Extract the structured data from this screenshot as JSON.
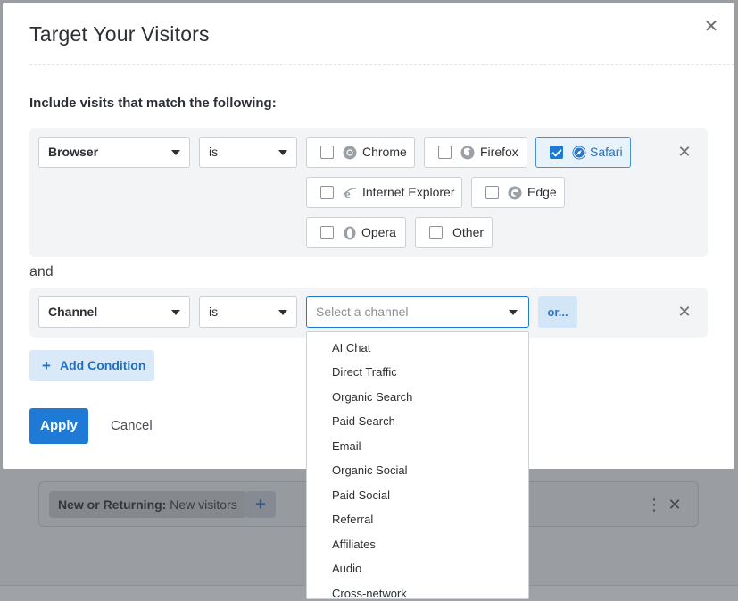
{
  "background": {
    "filter_chip_label": "New or Returning:",
    "filter_chip_value": "New visitors",
    "add_symbol": "+",
    "kebab_symbol": "⋮",
    "remove_symbol": "✕"
  },
  "modal": {
    "title": "Target Your Visitors",
    "close_symbol": "✕",
    "section_heading": "Include visits that match the following:",
    "join_word": "and",
    "condition1": {
      "field": "Browser",
      "operator": "is",
      "options": [
        {
          "label": "Chrome",
          "icon": "chrome-icon",
          "checked": false
        },
        {
          "label": "Firefox",
          "icon": "firefox-icon",
          "checked": false
        },
        {
          "label": "Safari",
          "icon": "safari-icon",
          "checked": true
        },
        {
          "label": "Internet Explorer",
          "icon": "internet-explorer-icon",
          "checked": false
        },
        {
          "label": "Edge",
          "icon": "edge-icon",
          "checked": false
        },
        {
          "label": "Opera",
          "icon": "opera-icon",
          "checked": false
        },
        {
          "label": "Other",
          "icon": "",
          "checked": false
        }
      ],
      "remove_symbol": "✕"
    },
    "condition2": {
      "field": "Channel",
      "operator": "is",
      "placeholder": "Select a channel",
      "or_label": "or...",
      "remove_symbol": "✕",
      "channel_options": [
        "AI Chat",
        "Direct Traffic",
        "Organic Search",
        "Paid Search",
        "Email",
        "Organic Social",
        "Paid Social",
        "Referral",
        "Affiliates",
        "Audio",
        "Cross-network"
      ]
    },
    "add_condition_symbol": "+",
    "add_condition_label": "Add Condition",
    "apply_label": "Apply",
    "cancel_label": "Cancel"
  },
  "colors": {
    "primary": "#1f7ad6",
    "selected_bg": "#e7f2fb",
    "row_bg": "#f2f4f6"
  }
}
